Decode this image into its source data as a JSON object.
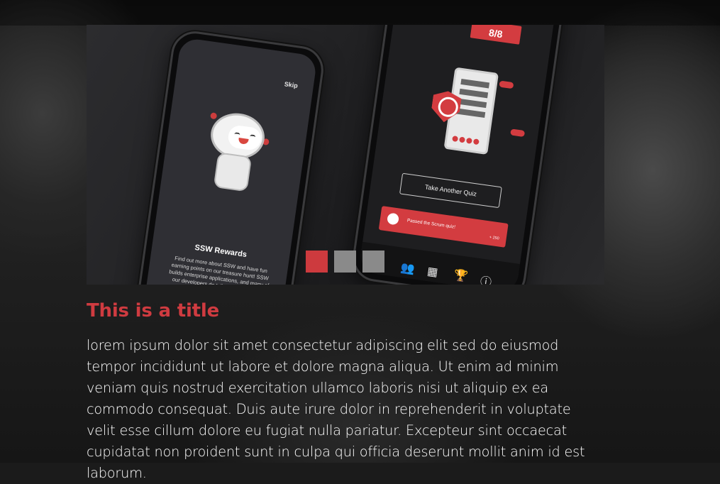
{
  "carousel": {
    "slide": {
      "left_phone": {
        "skip_label": "Skip",
        "title": "SSW Rewards",
        "description": "Find out more about SSW and have fun earning points on our treasure hunt! SSW builds enterprise applications, and many of our developers do talks at the premiere developer events around the world"
      },
      "right_phone": {
        "score": "8/8",
        "quiz_button": "Take Another Quiz",
        "notification_text": "Passed the Scrum quiz!",
        "notification_points": "+ 250"
      }
    },
    "indicators": [
      {
        "active": true
      },
      {
        "active": false
      },
      {
        "active": false
      }
    ],
    "accent_color": "#cd3a3e",
    "inactive_color": "#8a8a8a"
  },
  "content": {
    "title": "This is a title",
    "body": "lorem ipsum dolor sit amet consectetur adipiscing elit sed do eiusmod tempor incididunt ut labore et dolore magna aliqua. Ut enim ad minim veniam quis nostrud exercitation ullamco laboris nisi ut aliquip ex ea commodo consequat. Duis aute irure dolor in reprehenderit in voluptate velit esse cillum dolore eu fugiat nulla pariatur. Excepteur sint occaecat cupidatat non proident sunt in culpa qui officia deserunt mollit anim id est laborum."
  }
}
